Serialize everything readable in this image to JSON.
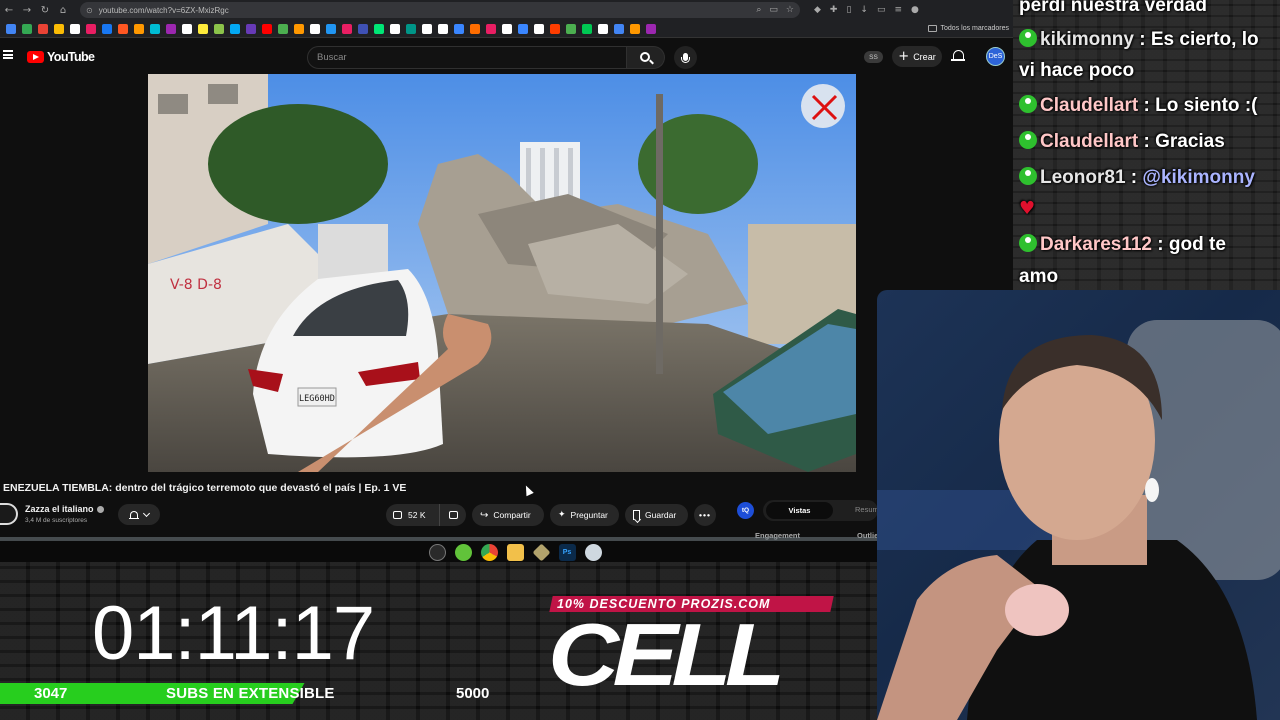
{
  "browser": {
    "url": "youtube.com/watch?v=6ZX-MxizRgc",
    "bookmarks_all_label": "Todos los marcadores",
    "bookmark_colors": [
      "#4285f4",
      "#34a853",
      "#ea4335",
      "#fbbc05",
      "#ffffff",
      "#e91e63",
      "#1877f2",
      "#ff5722",
      "#ff9800",
      "#00bcd4",
      "#9c27b0",
      "#ffffff",
      "#ffeb3b",
      "#8bc34a",
      "#03a9f4",
      "#673ab7",
      "#ff0000",
      "#4caf50",
      "#ff9800",
      "#ffffff",
      "#2196f3",
      "#e91e63",
      "#3f51b5",
      "#00e676",
      "#ffffff",
      "#009688",
      "#ffffff",
      "#ffffff",
      "#3a86ff",
      "#ff6d00",
      "#e91e63",
      "#ffffff",
      "#3a86ff",
      "#ffffff",
      "#ff3d00",
      "#4caf50",
      "#00c853",
      "#ffffff",
      "#4285f4",
      "#ff9800",
      "#9c27b0"
    ]
  },
  "youtube": {
    "logo_text": "YouTube",
    "search_placeholder": "Buscar",
    "ss_badge": "SS",
    "create_label": "Crear",
    "avatar_text": "DeS",
    "video_title": "ENEZUELA TIEMBLA: dentro del trágico terremoto que devastó el país | Ep. 1 VE",
    "channel_name": "Zazza el italiano",
    "channel_subs": "3,4 M de suscriptores",
    "like_count": "52 K",
    "share_label": "Compartir",
    "ask_label": "Preguntar",
    "save_label": "Guardar",
    "more_label": "•••",
    "side_panel": {
      "icon_text": "tQ",
      "tab_active": "Vistas",
      "tab_other": "Resumen",
      "engagement_label": "Engagement",
      "outlier_label": "Outlie"
    },
    "video_plate_text": "LEG60HD",
    "graffiti_text": "V-8 D-8"
  },
  "chat": {
    "messages": [
      {
        "user": "",
        "text": "perdí nuestra verdad"
      },
      {
        "user": "kikimonny",
        "text": "Es cierto, lo"
      },
      {
        "user": "",
        "text": "vi hace poco"
      },
      {
        "user": "Claudellart",
        "text": "Lo siento :("
      },
      {
        "user": "Claudellart",
        "text": "Gracias"
      },
      {
        "user": "Leonor81",
        "mention": "@kikimonny",
        "heart": "♥"
      },
      {
        "user": "Darkares112",
        "text": "god te"
      },
      {
        "user": "",
        "text": "amo"
      }
    ]
  },
  "stream_overlay": {
    "timer": "01:11:17",
    "subs_current": "3047",
    "subs_label": "SUBS EN EXTENSIBLE",
    "subs_goal": "5000",
    "subs_progress": 0.609,
    "promo_text": "10% DESCUENTO PROZIS.COM",
    "cell_text": "CELL"
  },
  "colors": {
    "youtube_red": "#ff0000",
    "subs_bar_green": "#27ce1e",
    "promo_magenta": "#c01446",
    "chat_user_icon": "#2ec02e"
  }
}
